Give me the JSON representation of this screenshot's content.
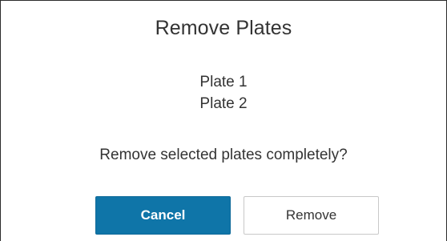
{
  "dialog": {
    "title": "Remove Plates",
    "plates": [
      "Plate 1",
      "Plate 2"
    ],
    "question": "Remove selected plates completely?",
    "buttons": {
      "cancel_label": "Cancel",
      "remove_label": "Remove"
    }
  },
  "colors": {
    "primary_button": "#0f75a8",
    "text": "#333333"
  }
}
